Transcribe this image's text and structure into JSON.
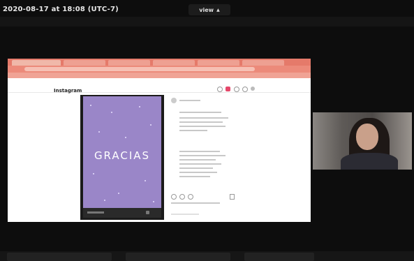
{
  "zoom": {
    "timestamp": "2020-08-17 at 18:08 (UTC-7)",
    "view_label": "view",
    "view_caret": "▲"
  },
  "shared_screen": {
    "browser_accent": "#e57a6a",
    "instagram": {
      "logo_text": "Instagram",
      "story_text": "GRACIAS",
      "story_bg": "#9a86c8"
    }
  },
  "participant_video": {
    "present": true
  }
}
